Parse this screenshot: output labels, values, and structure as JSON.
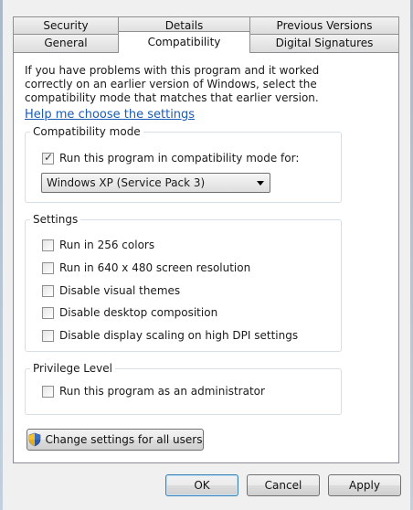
{
  "tabs": {
    "row1": [
      "Security",
      "Details",
      "Previous Versions"
    ],
    "row2": [
      "General",
      "Compatibility",
      "Digital Signatures"
    ]
  },
  "intro_text": "If you have problems with this program and it worked correctly on an earlier version of Windows, select the compatibility mode that matches that earlier version.",
  "help_link": "Help me choose the settings",
  "compat_mode": {
    "title": "Compatibility mode",
    "checkbox_label": "Run this program in compatibility mode for:",
    "checked": true,
    "selected_os": "Windows XP (Service Pack 3)"
  },
  "settings": {
    "title": "Settings",
    "items": [
      {
        "label": "Run in 256 colors",
        "checked": false
      },
      {
        "label": "Run in 640 x 480 screen resolution",
        "checked": false
      },
      {
        "label": "Disable visual themes",
        "checked": false
      },
      {
        "label": "Disable desktop composition",
        "checked": false
      },
      {
        "label": "Disable display scaling on high DPI settings",
        "checked": false
      }
    ]
  },
  "privilege": {
    "title": "Privilege Level",
    "checkbox_label": "Run this program as an administrator",
    "checked": false
  },
  "change_all_button": "Change settings for all users",
  "buttons": {
    "ok": "OK",
    "cancel": "Cancel",
    "apply": "Apply"
  },
  "colors": {
    "link": "#1a5bb5",
    "panel_border": "#898c95",
    "group_border": "#d5dfe5"
  }
}
